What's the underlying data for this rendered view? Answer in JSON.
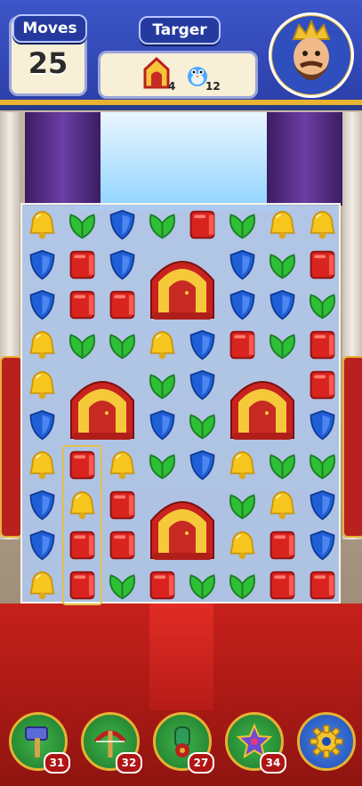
{
  "header": {
    "moves_label": "Moves",
    "moves_count": "25",
    "target_label": "Targer",
    "goals": [
      {
        "icon": "doghouse-icon",
        "count": "4"
      },
      {
        "icon": "bird-icon",
        "count": "12"
      }
    ]
  },
  "board": {
    "rows": 10,
    "cols": 8,
    "pieces": [
      {
        "r": 0,
        "c": 0,
        "t": "bell"
      },
      {
        "r": 0,
        "c": 1,
        "t": "leaf"
      },
      {
        "r": 0,
        "c": 2,
        "t": "shield"
      },
      {
        "r": 0,
        "c": 3,
        "t": "leaf"
      },
      {
        "r": 0,
        "c": 4,
        "t": "book"
      },
      {
        "r": 0,
        "c": 5,
        "t": "leaf"
      },
      {
        "r": 0,
        "c": 6,
        "t": "bell"
      },
      {
        "r": 0,
        "c": 7,
        "t": "bell"
      },
      {
        "r": 1,
        "c": 0,
        "t": "shield"
      },
      {
        "r": 1,
        "c": 1,
        "t": "book"
      },
      {
        "r": 1,
        "c": 2,
        "t": "shield"
      },
      {
        "r": 1,
        "c": 5,
        "t": "shield"
      },
      {
        "r": 1,
        "c": 6,
        "t": "leaf"
      },
      {
        "r": 1,
        "c": 7,
        "t": "book"
      },
      {
        "r": 2,
        "c": 0,
        "t": "shield"
      },
      {
        "r": 2,
        "c": 1,
        "t": "book"
      },
      {
        "r": 2,
        "c": 2,
        "t": "book"
      },
      {
        "r": 2,
        "c": 5,
        "t": "shield"
      },
      {
        "r": 2,
        "c": 6,
        "t": "shield"
      },
      {
        "r": 2,
        "c": 7,
        "t": "leaf"
      },
      {
        "r": 3,
        "c": 0,
        "t": "bell"
      },
      {
        "r": 3,
        "c": 1,
        "t": "leaf"
      },
      {
        "r": 3,
        "c": 2,
        "t": "leaf"
      },
      {
        "r": 3,
        "c": 3,
        "t": "bell"
      },
      {
        "r": 3,
        "c": 4,
        "t": "shield"
      },
      {
        "r": 3,
        "c": 5,
        "t": "book"
      },
      {
        "r": 3,
        "c": 6,
        "t": "leaf"
      },
      {
        "r": 3,
        "c": 7,
        "t": "book"
      },
      {
        "r": 4,
        "c": 0,
        "t": "bell"
      },
      {
        "r": 4,
        "c": 3,
        "t": "leaf"
      },
      {
        "r": 4,
        "c": 4,
        "t": "shield"
      },
      {
        "r": 4,
        "c": 7,
        "t": "book"
      },
      {
        "r": 5,
        "c": 0,
        "t": "shield"
      },
      {
        "r": 5,
        "c": 3,
        "t": "shield"
      },
      {
        "r": 5,
        "c": 4,
        "t": "leaf"
      },
      {
        "r": 5,
        "c": 7,
        "t": "shield"
      },
      {
        "r": 6,
        "c": 0,
        "t": "bell"
      },
      {
        "r": 6,
        "c": 1,
        "t": "book"
      },
      {
        "r": 6,
        "c": 2,
        "t": "bell"
      },
      {
        "r": 6,
        "c": 3,
        "t": "leaf"
      },
      {
        "r": 6,
        "c": 4,
        "t": "shield"
      },
      {
        "r": 6,
        "c": 5,
        "t": "bell"
      },
      {
        "r": 6,
        "c": 6,
        "t": "leaf"
      },
      {
        "r": 6,
        "c": 7,
        "t": "leaf"
      },
      {
        "r": 7,
        "c": 0,
        "t": "shield"
      },
      {
        "r": 7,
        "c": 1,
        "t": "bell"
      },
      {
        "r": 7,
        "c": 2,
        "t": "book"
      },
      {
        "r": 7,
        "c": 5,
        "t": "leaf"
      },
      {
        "r": 7,
        "c": 6,
        "t": "bell"
      },
      {
        "r": 7,
        "c": 7,
        "t": "shield"
      },
      {
        "r": 8,
        "c": 0,
        "t": "shield"
      },
      {
        "r": 8,
        "c": 1,
        "t": "book"
      },
      {
        "r": 8,
        "c": 2,
        "t": "book"
      },
      {
        "r": 8,
        "c": 5,
        "t": "bell"
      },
      {
        "r": 8,
        "c": 6,
        "t": "book"
      },
      {
        "r": 8,
        "c": 7,
        "t": "shield"
      },
      {
        "r": 9,
        "c": 0,
        "t": "bell"
      },
      {
        "r": 9,
        "c": 1,
        "t": "book"
      },
      {
        "r": 9,
        "c": 2,
        "t": "leaf"
      },
      {
        "r": 9,
        "c": 3,
        "t": "book"
      },
      {
        "r": 9,
        "c": 4,
        "t": "leaf"
      },
      {
        "r": 9,
        "c": 5,
        "t": "leaf"
      },
      {
        "r": 9,
        "c": 6,
        "t": "book"
      },
      {
        "r": 9,
        "c": 7,
        "t": "book"
      }
    ],
    "houses": [
      {
        "r": 1,
        "c": 3
      },
      {
        "r": 4,
        "c": 1
      },
      {
        "r": 4,
        "c": 5
      },
      {
        "r": 7,
        "c": 3
      }
    ],
    "highlight_column": 1
  },
  "boosters": [
    {
      "name": "hammer-booster",
      "icon": "hammer-icon",
      "count": "31"
    },
    {
      "name": "crossbow-booster",
      "icon": "crossbow-icon",
      "count": "32"
    },
    {
      "name": "cannon-booster",
      "icon": "cannon-icon",
      "count": "27"
    },
    {
      "name": "jester-hat-booster",
      "icon": "jester-hat-icon",
      "count": "34"
    }
  ],
  "settings": {
    "icon": "gear-icon"
  },
  "colors": {
    "header_blue": "#2b3fa8",
    "gold": "#e6b233",
    "book_red": "#d8231f",
    "leaf_green": "#2fbf36",
    "shield_blue": "#1f5fd6",
    "bell_yellow": "#f6c51e",
    "board_bg": "#afc8f0",
    "carpet_red": "#c7201b"
  }
}
